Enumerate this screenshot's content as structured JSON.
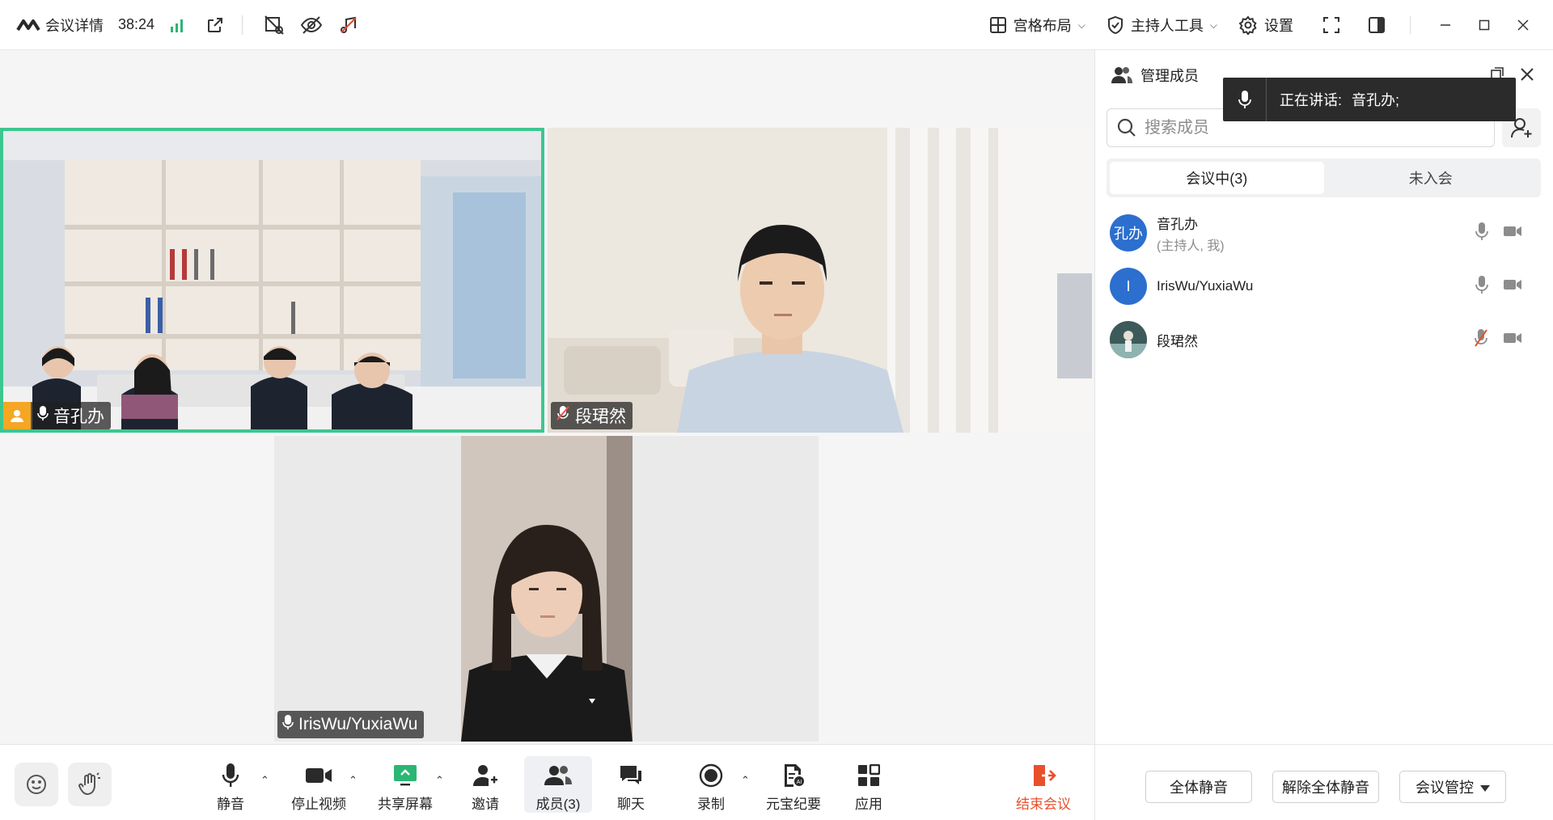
{
  "titlebar": {
    "meeting_details": "会议详情",
    "elapsed": "38:24",
    "layout_label": "宫格布局",
    "host_tools_label": "主持人工具",
    "settings_label": "设置"
  },
  "tiles": [
    {
      "name": "音孔办",
      "is_host": true,
      "muted": false,
      "active_speaker": true
    },
    {
      "name": "段珺然",
      "is_host": false,
      "muted": true,
      "active_speaker": false
    },
    {
      "name": "IrisWu/YuxiaWu",
      "is_host": false,
      "muted": false,
      "active_speaker": false
    }
  ],
  "toolbar": {
    "mute": "静音",
    "stop_video": "停止视频",
    "share_screen": "共享屏幕",
    "invite": "邀请",
    "members": "成员(3)",
    "chat": "聊天",
    "record": "录制",
    "summary": "元宝纪要",
    "apps": "应用",
    "end_meeting": "结束会议"
  },
  "panel": {
    "title": "管理成员",
    "search_placeholder": "搜索成员",
    "tabs": [
      "会议中(3)",
      "未入会"
    ],
    "members": [
      {
        "avatar_text": "孔办",
        "name": "音孔办",
        "sub": "(主持人, 我)",
        "muted": false
      },
      {
        "avatar_text": "I",
        "name": "IrisWu/YuxiaWu",
        "sub": "",
        "muted": false
      },
      {
        "avatar_text": "",
        "name": "段珺然",
        "sub": "",
        "muted": true
      }
    ],
    "footer": {
      "mute_all": "全体静音",
      "unmute_all": "解除全体静音",
      "meeting_control": "会议管控"
    }
  },
  "toast": {
    "prefix": "正在讲话:",
    "speaker": "音孔办;"
  },
  "colors": {
    "active_border": "#3cc78f",
    "end_meeting": "#e8502c",
    "host_badge": "#f5a623",
    "avatar_blue": "#2c6fce"
  }
}
